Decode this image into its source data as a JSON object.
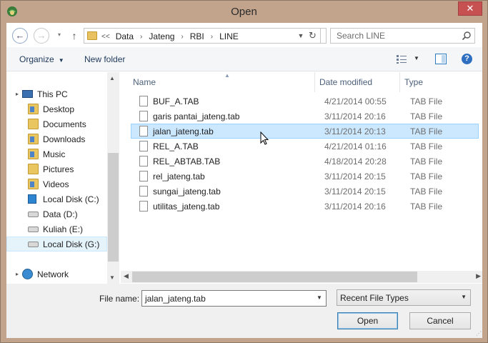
{
  "window": {
    "title": "Open",
    "close_label": "✕"
  },
  "address": {
    "overflow": "<<",
    "crumbs": [
      "Data",
      "Jateng",
      "RBI",
      "LINE"
    ]
  },
  "search": {
    "placeholder": "Search LINE"
  },
  "toolbar": {
    "organize_label": "Organize",
    "new_folder_label": "New folder",
    "help_label": "?"
  },
  "nav": {
    "items": [
      {
        "label": "This PC",
        "icon": "pc-icon"
      },
      {
        "label": "Desktop",
        "icon": "folder-icon"
      },
      {
        "label": "Documents",
        "icon": "folder-icon"
      },
      {
        "label": "Downloads",
        "icon": "folder-icon"
      },
      {
        "label": "Music",
        "icon": "folder-icon"
      },
      {
        "label": "Pictures",
        "icon": "folder-icon"
      },
      {
        "label": "Videos",
        "icon": "folder-icon"
      },
      {
        "label": "Local Disk (C:)",
        "icon": "windows-drive-icon"
      },
      {
        "label": "Data (D:)",
        "icon": "drive-icon"
      },
      {
        "label": "Kuliah (E:)",
        "icon": "drive-icon"
      },
      {
        "label": "Local Disk (G:)",
        "icon": "drive-icon"
      },
      {
        "label": "Network",
        "icon": "network-icon"
      }
    ],
    "selected": "Local Disk (G:)"
  },
  "files": {
    "columns": [
      "Name",
      "Date modified",
      "Type"
    ],
    "rows": [
      {
        "name": "BUF_A.TAB",
        "date": "4/21/2014 00:55",
        "type": "TAB File"
      },
      {
        "name": "garis pantai_jateng.tab",
        "date": "3/11/2014 20:16",
        "type": "TAB File"
      },
      {
        "name": "jalan_jateng.tab",
        "date": "3/11/2014 20:13",
        "type": "TAB File"
      },
      {
        "name": "REL_A.TAB",
        "date": "4/21/2014 01:16",
        "type": "TAB File"
      },
      {
        "name": "REL_ABTAB.TAB",
        "date": "4/18/2014 20:28",
        "type": "TAB File"
      },
      {
        "name": "rel_jateng.tab",
        "date": "3/11/2014 20:15",
        "type": "TAB File"
      },
      {
        "name": "sungai_jateng.tab",
        "date": "3/11/2014 20:15",
        "type": "TAB File"
      },
      {
        "name": "utilitas_jateng.tab",
        "date": "3/11/2014 20:16",
        "type": "TAB File"
      }
    ],
    "selected": "jalan_jateng.tab"
  },
  "footer": {
    "file_name_label": "File name:",
    "file_name_value": "jalan_jateng.tab",
    "file_type_value": "Recent File Types",
    "open_label": "Open",
    "cancel_label": "Cancel"
  }
}
